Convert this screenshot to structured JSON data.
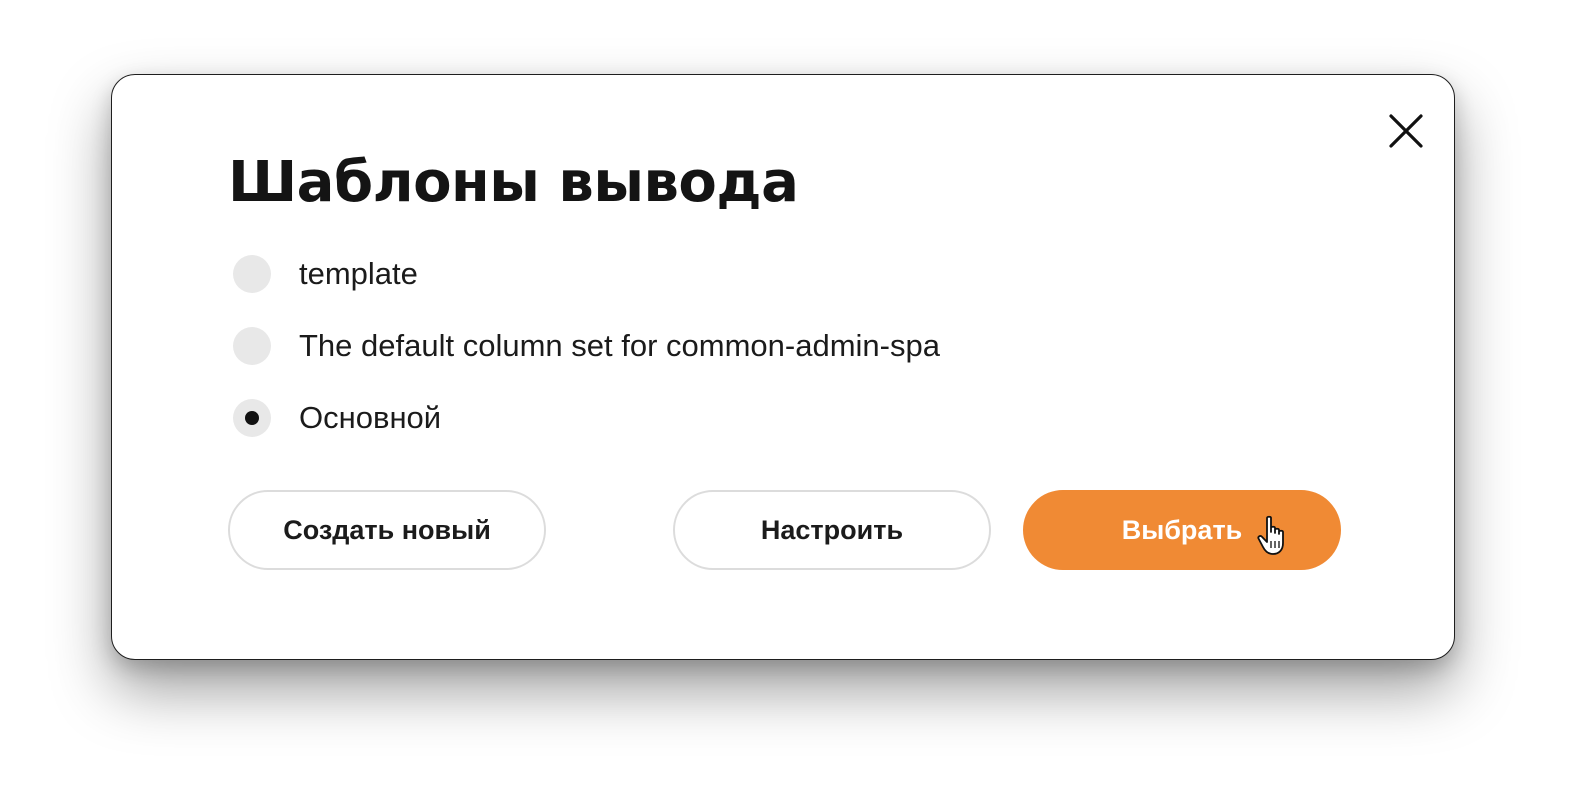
{
  "dialog": {
    "title": "Шаблоны вывода",
    "close_icon": "close-icon",
    "options": [
      {
        "label": "template",
        "checked": false
      },
      {
        "label": "The default column set for common-admin-spa",
        "checked": false
      },
      {
        "label": "Основной",
        "checked": true
      }
    ],
    "buttons": {
      "create_label": "Создать новый",
      "configure_label": "Настроить",
      "select_label": "Выбрать"
    },
    "cursor_icon": "hand-pointer-icon"
  },
  "colors": {
    "accent": "#f08a34",
    "radio_bg": "#e8e8e8",
    "outline_border": "#dcdcdc",
    "text": "#141414"
  }
}
